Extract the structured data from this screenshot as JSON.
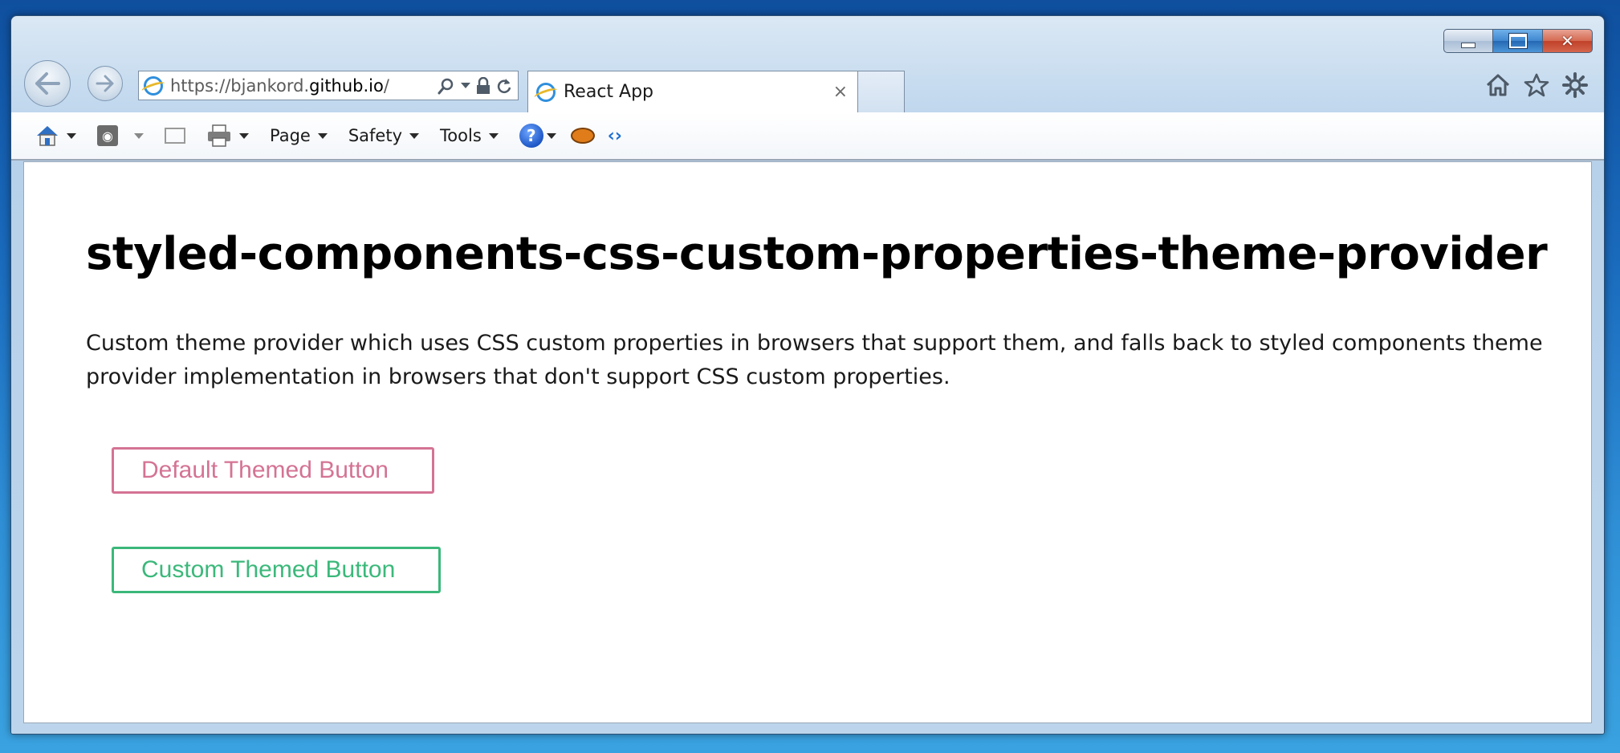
{
  "browser": {
    "address_bar": {
      "url_prefix": "https://bjankord.",
      "url_domain": "github.io",
      "url_suffix": "/"
    },
    "tab": {
      "title": "React App",
      "close_glyph": "×"
    },
    "command_bar": {
      "page_label": "Page",
      "safety_label": "Safety",
      "tools_label": "Tools",
      "help_glyph": "?"
    },
    "icons": {
      "back": "back-arrow-icon",
      "forward": "forward-arrow-icon",
      "search": "search-icon",
      "lock": "lock-icon",
      "refresh": "refresh-icon",
      "home": "home-icon",
      "favorites": "star-icon",
      "settings": "gear-icon"
    }
  },
  "page": {
    "title": "styled-components-css-custom-properties-theme-provider",
    "description": "Custom theme provider which uses CSS custom properties in browsers that support them, and falls back to styled components theme provider implementation in browsers that don't support CSS custom properties.",
    "buttons": {
      "default_label": "Default Themed Button",
      "custom_label": "Custom Themed Button"
    }
  },
  "colors": {
    "default_theme": "#d47394",
    "custom_theme": "#3bb87a"
  }
}
